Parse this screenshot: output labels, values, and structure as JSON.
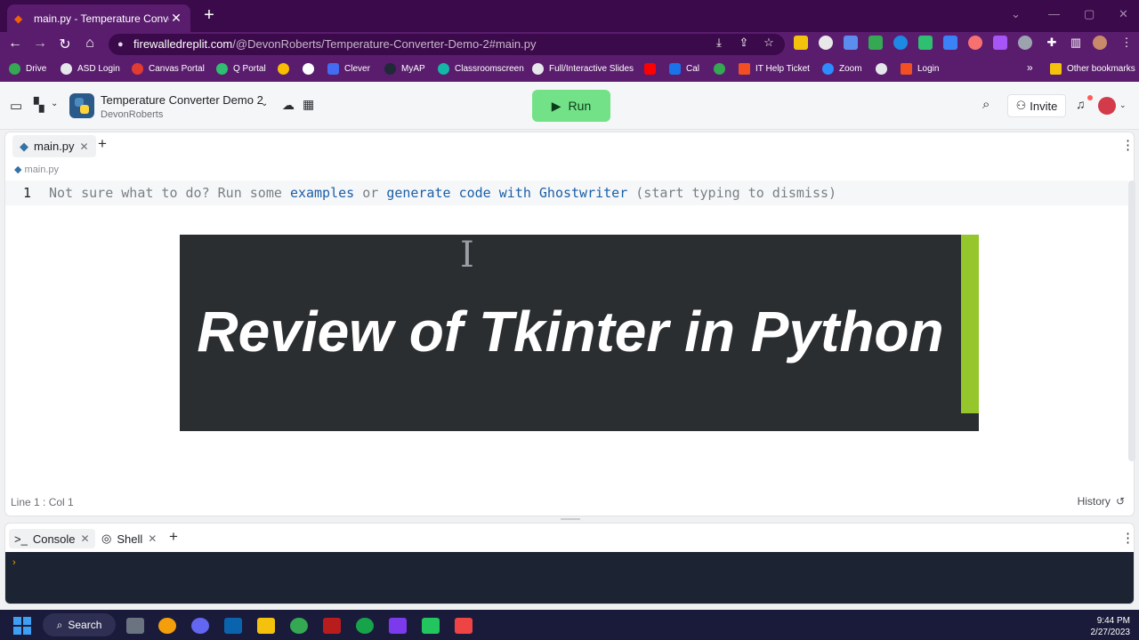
{
  "browser": {
    "tab_title": "main.py - Temperature Converter De",
    "tab_close": "✕",
    "new_tab": "+",
    "url_host": "firewalledreplit.com",
    "url_path": "/@DevonRoberts/Temperature-Converter-Demo-2#main.py",
    "bookmarks": [
      "Drive",
      "ASD Login",
      "Canvas Portal",
      "Q Portal",
      "Clever",
      "MyAP",
      "Classroomscreen",
      "Full/Interactive Slides",
      "Cal",
      "IT Help Ticket",
      "Zoom",
      "Login"
    ],
    "bookmark_overflow": "»",
    "other_bookmarks": "Other bookmarks"
  },
  "header": {
    "project_title": "Temperature Converter Demo 2",
    "owner": "DevonRoberts",
    "run_label": "Run",
    "invite_label": "Invite"
  },
  "editor": {
    "tab_label": "main.py",
    "breadcrumb": "main.py",
    "line_number": "1",
    "placeholder_start": "Not sure what to do? Run some ",
    "link_examples": "examples",
    "placeholder_mid": " or ",
    "link_ghostwriter": "generate code with Ghostwriter",
    "placeholder_end": " (start typing to dismiss)",
    "status": "Line 1 : Col 1",
    "history_label": "History"
  },
  "overlay": {
    "heading": "Review of Tkinter in Python"
  },
  "console": {
    "tabs": [
      {
        "label": "Console",
        "icon": "terminal-icon"
      },
      {
        "label": "Shell",
        "icon": "shell-icon"
      }
    ],
    "prompt": "›"
  },
  "taskbar": {
    "search_label": "Search",
    "time": "9:44 PM",
    "date": "2/27/2023"
  },
  "colors": {
    "run_green": "#73e187",
    "card_accent": "#95c62c",
    "browser_purple": "#5a1d6e"
  }
}
